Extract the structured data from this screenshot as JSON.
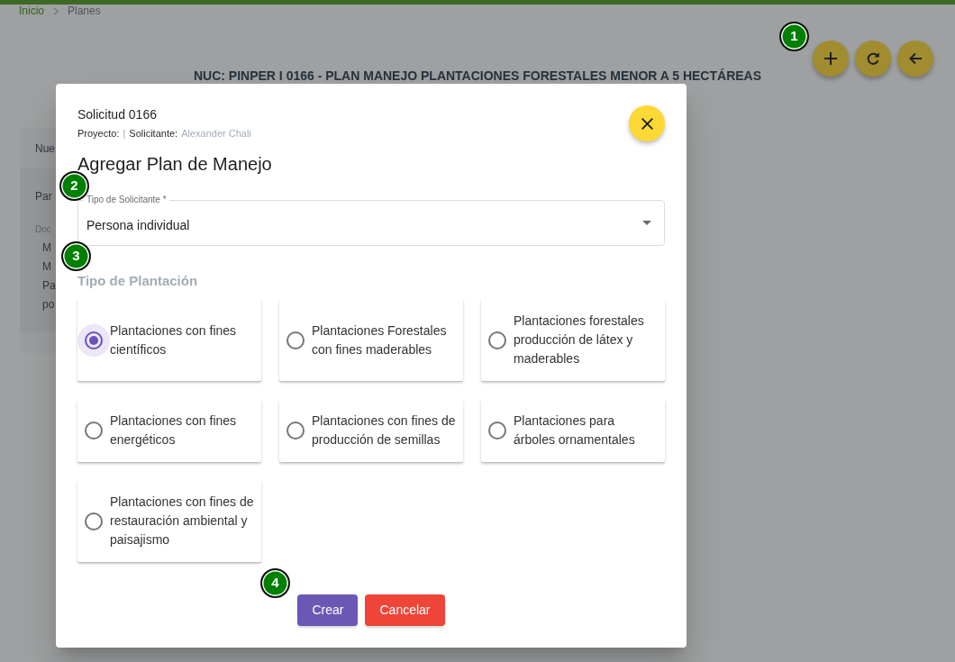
{
  "breadcrumb": [
    {
      "label": "Inicio",
      "current": false
    },
    {
      "label": "Planes",
      "current": true
    }
  ],
  "page_title": "NUC: PINPER I 0166 - PLAN MANEJO PLANTACIONES FORESTALES MENOR A 5 HECTÁREAS",
  "background_panel": {
    "header": "Nue",
    "title": "Par",
    "caption": "Doc",
    "items": [
      "M",
      "M",
      "Pa",
      "po"
    ]
  },
  "dialog": {
    "title": "Solicitud 0166",
    "project_label": "Proyecto:",
    "separator": "|",
    "applicant_label": "Solicitante:",
    "applicant_name": "Alexander Chali",
    "heading": "Agregar Plan de Manejo",
    "applicant_type": {
      "label": "Tipo de Solicitante *",
      "value": "Persona individual"
    },
    "plantation_type": {
      "label": "Tipo de Plantación",
      "options": [
        {
          "label": "Plantaciones con fines científicos",
          "selected": true
        },
        {
          "label": "Plantaciones Forestales con fines maderables",
          "selected": false
        },
        {
          "label": "Plantaciones forestales producción de látex y maderables",
          "selected": false
        },
        {
          "label": "Plantaciones con fines energéticos",
          "selected": false
        },
        {
          "label": "Plantaciones con fines de producción de semillas",
          "selected": false
        },
        {
          "label": "Plantaciones para árboles ornamentales",
          "selected": false
        },
        {
          "label": "Plantaciones con fines de restauración ambiental y paisajismo",
          "selected": false
        }
      ]
    },
    "buttons": [
      {
        "label": "Crear",
        "kind": "primary"
      },
      {
        "label": "Cancelar",
        "kind": "danger"
      }
    ]
  },
  "markers": [
    {
      "label": "1"
    },
    {
      "label": "2"
    },
    {
      "label": "3"
    },
    {
      "label": "4"
    }
  ]
}
